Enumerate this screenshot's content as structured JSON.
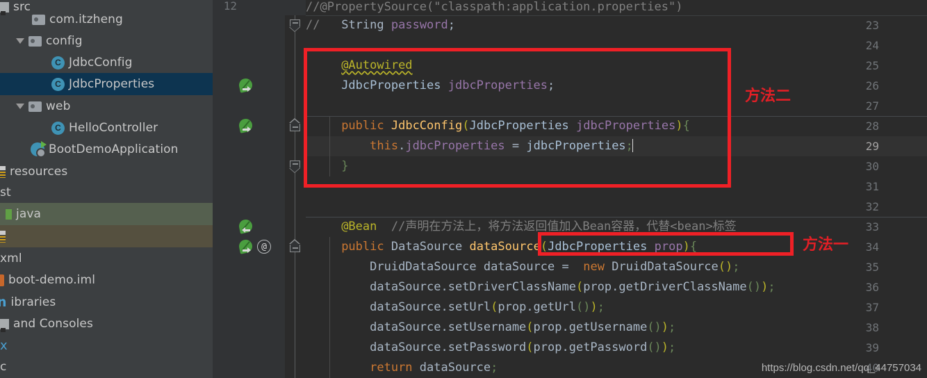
{
  "sidebar": {
    "items": [
      {
        "label": "src",
        "icon": "module-icon",
        "indent": 0,
        "state": "clipped-top"
      },
      {
        "label": "com.itzheng",
        "icon": "folder-icon",
        "indent": 46,
        "state": "normal"
      },
      {
        "label": "config",
        "icon": "folder-icon",
        "indent": 46,
        "state": "expanded"
      },
      {
        "label": "JdbcConfig",
        "icon": "class-icon",
        "indent": 74,
        "state": "normal"
      },
      {
        "label": "JdbcProperties",
        "icon": "class-icon",
        "indent": 74,
        "state": "selected"
      },
      {
        "label": "web",
        "icon": "folder-icon",
        "indent": 46,
        "state": "expanded"
      },
      {
        "label": "HelloController",
        "icon": "class-icon",
        "indent": 74,
        "state": "normal"
      },
      {
        "label": "BootDemoApplication",
        "icon": "spring-app-icon",
        "indent": 46,
        "state": "normal"
      },
      {
        "label": "resources",
        "icon": "resources-icon",
        "indent": 0,
        "state": "normal"
      },
      {
        "label": "st",
        "icon": "none",
        "indent": 0,
        "state": "clipped"
      },
      {
        "label": "java",
        "icon": "source-root-icon",
        "indent": 14,
        "state": "green-highlight"
      },
      {
        "label": "",
        "icon": "none",
        "indent": 0,
        "state": "brown-highlight"
      },
      {
        "label": "xml",
        "icon": "none",
        "indent": 0,
        "state": "clipped"
      },
      {
        "label": "boot-demo.iml",
        "icon": "module-file-icon",
        "indent": 0,
        "state": "clipped"
      },
      {
        "label": "ibraries",
        "icon": "none",
        "indent": 0,
        "state": "clipped"
      },
      {
        "label": " and Consoles",
        "icon": "console-icon",
        "indent": 0,
        "state": "clipped"
      },
      {
        "label": "",
        "icon": "none",
        "indent": 0,
        "state": "clipped"
      },
      {
        "label": "",
        "icon": "none",
        "indent": 0,
        "state": "clipped"
      }
    ]
  },
  "editor": {
    "sticky_header": "//@PropertySource(\"classpath:application.properties\")",
    "sticky_line_number": "12",
    "current_line": 29,
    "lines": [
      {
        "n": 23,
        "text": "    String password;",
        "gutter": "none",
        "fold": "up",
        "prefix": "//"
      },
      {
        "n": 24,
        "text": "",
        "gutter": "none",
        "fold": "none"
      },
      {
        "n": 25,
        "text": "    @Autowired",
        "gutter": "none",
        "fold": "none"
      },
      {
        "n": 26,
        "text": "    JdbcProperties jdbcProperties;",
        "gutter": "bean-right",
        "fold": "none"
      },
      {
        "n": 27,
        "text": "",
        "gutter": "none",
        "fold": "none"
      },
      {
        "n": 28,
        "text": "    public JdbcConfig(JdbcProperties jdbcProperties){",
        "gutter": "bean-right",
        "fold": "down"
      },
      {
        "n": 29,
        "text": "        this.jdbcProperties = jdbcProperties;",
        "gutter": "none",
        "fold": "none"
      },
      {
        "n": 30,
        "text": "    }",
        "gutter": "none",
        "fold": "up"
      },
      {
        "n": 31,
        "text": "",
        "gutter": "none",
        "fold": "none"
      },
      {
        "n": 32,
        "text": "",
        "gutter": "none",
        "fold": "none"
      },
      {
        "n": 33,
        "text": "    @Bean  //声明在方法上，将方法返回值加入Bean容器，代替<bean>标签",
        "gutter": "bean-left",
        "fold": "none"
      },
      {
        "n": 34,
        "text": "    public DataSource dataSource(JdbcProperties prop){",
        "gutter": "bean-right-at",
        "fold": "down"
      },
      {
        "n": 35,
        "text": "        DruidDataSource dataSource =  new DruidDataSource();",
        "gutter": "none",
        "fold": "none"
      },
      {
        "n": 36,
        "text": "        dataSource.setDriverClassName(prop.getDriverClassName());",
        "gutter": "none",
        "fold": "none"
      },
      {
        "n": 37,
        "text": "        dataSource.setUrl(prop.getUrl());",
        "gutter": "none",
        "fold": "none"
      },
      {
        "n": 38,
        "text": "        dataSource.setUsername(prop.getUsername());",
        "gutter": "none",
        "fold": "none"
      },
      {
        "n": 39,
        "text": "        dataSource.setPassword(prop.getPassword());",
        "gutter": "none",
        "fold": "none"
      },
      {
        "n": 40,
        "text": "        return dataSource;",
        "gutter": "none",
        "fold": "none"
      }
    ]
  },
  "annotations": {
    "box_one_label": "方法二",
    "box_two_label": "方法一",
    "box_color": "#ef2026"
  },
  "watermark": "https://blog.csdn.net/qq_44757034"
}
